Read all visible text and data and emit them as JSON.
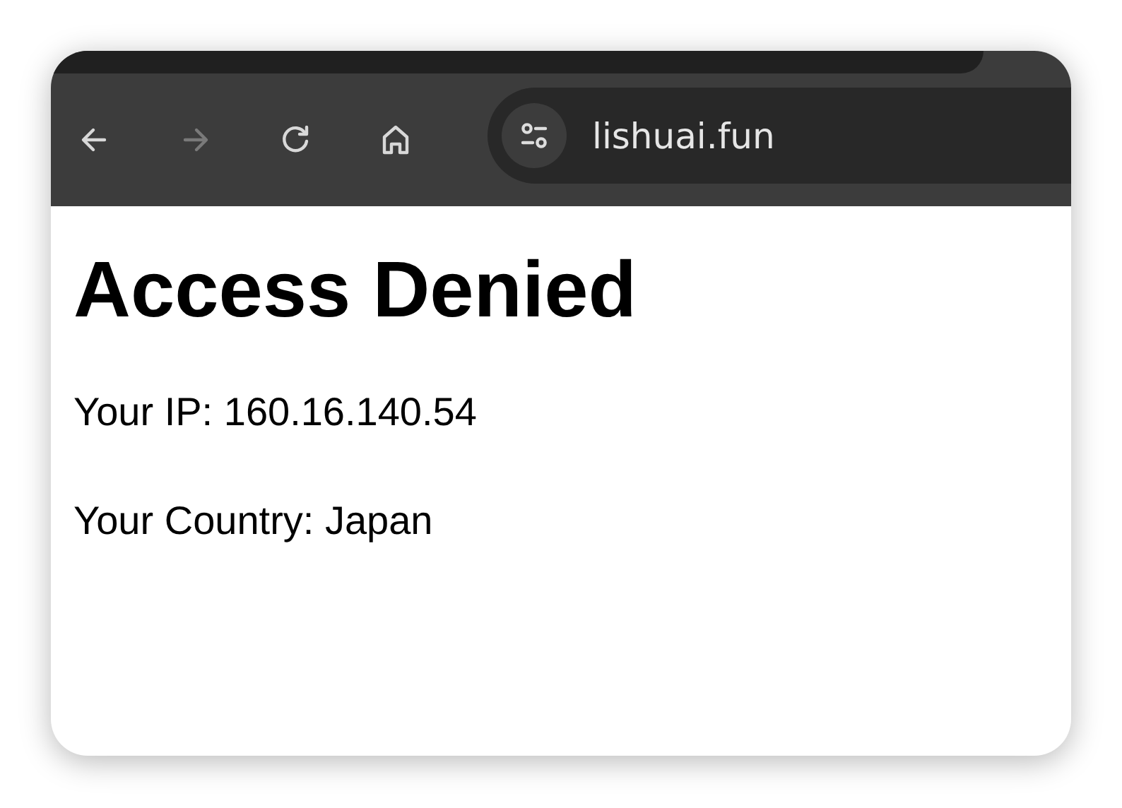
{
  "toolbar": {
    "buttons": [
      {
        "kind": "back",
        "disabled": false
      },
      {
        "kind": "forward",
        "disabled": true
      },
      {
        "kind": "reload",
        "disabled": false
      },
      {
        "kind": "home",
        "disabled": false
      }
    ]
  },
  "address_bar": {
    "value": "lishuai.fun"
  },
  "page": {
    "heading": "Access Denied",
    "paragraphs": [
      "Your IP: 160.16.140.54",
      "Your Country: Japan"
    ]
  }
}
